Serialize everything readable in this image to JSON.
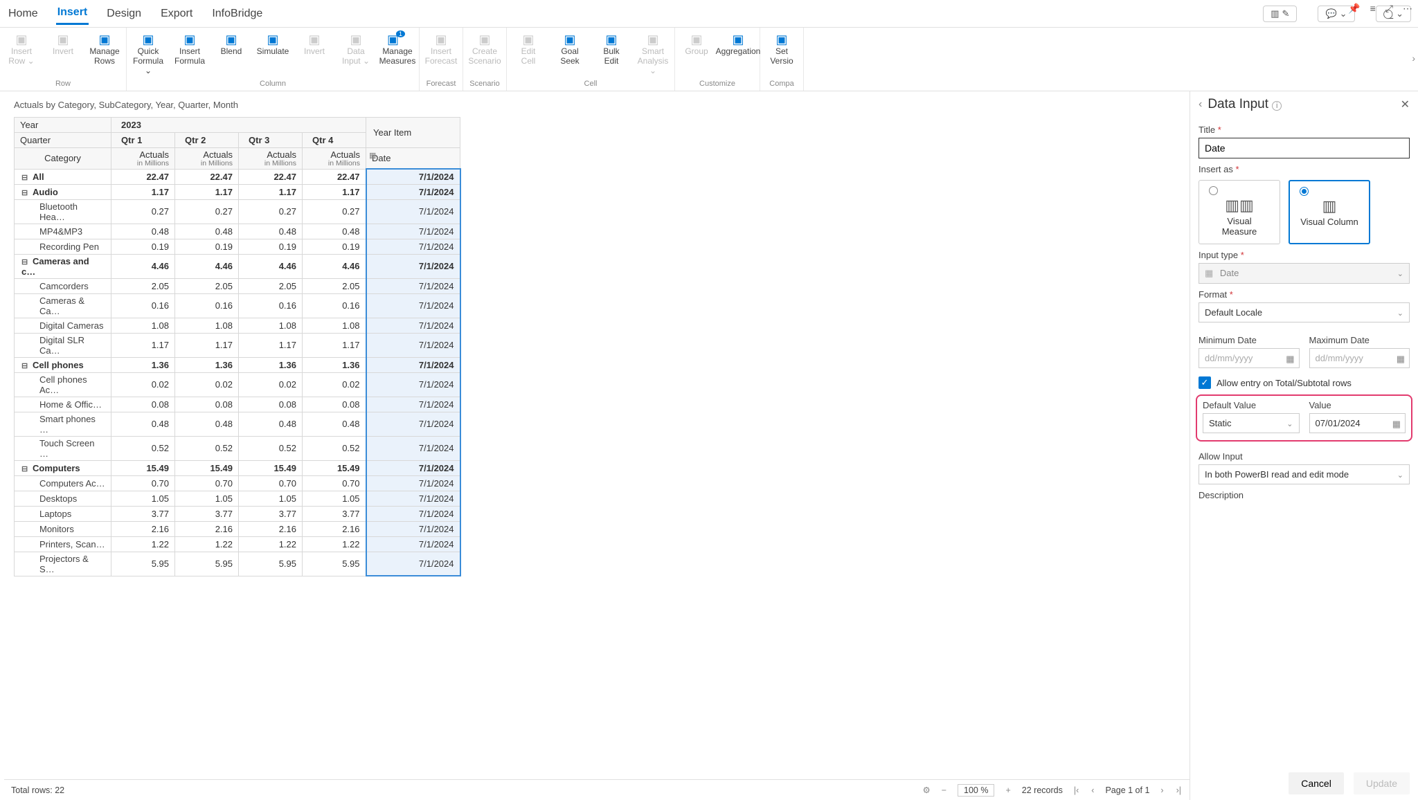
{
  "tabs": [
    "Home",
    "Insert",
    "Design",
    "Export",
    "InfoBridge"
  ],
  "active_tab": 1,
  "ribbon": {
    "groups": [
      {
        "label": "Row",
        "items": [
          {
            "name": "insert-row",
            "label": "Insert Row",
            "icon": "row",
            "disabled": true,
            "chev": true
          },
          {
            "name": "invert",
            "label": "Invert",
            "icon": "invert",
            "disabled": true
          },
          {
            "name": "manage-rows",
            "label": "Manage Rows",
            "icon": "rows",
            "disabled": false
          }
        ]
      },
      {
        "label": "Column",
        "items": [
          {
            "name": "quick-formula",
            "label": "Quick Formula",
            "icon": "bolt",
            "chev": true
          },
          {
            "name": "insert-formula",
            "label": "Insert Formula",
            "icon": "fx"
          },
          {
            "name": "blend",
            "label": "Blend",
            "icon": "blend"
          },
          {
            "name": "simulate",
            "label": "Simulate",
            "icon": "sim"
          },
          {
            "name": "invert-col",
            "label": "Invert",
            "icon": "invertc",
            "disabled": true
          },
          {
            "name": "data-input",
            "label": "Data Input",
            "icon": "di",
            "disabled": true,
            "chev": true
          },
          {
            "name": "manage-measures",
            "label": "Manage Measures",
            "icon": "mm",
            "badge": "1"
          }
        ]
      },
      {
        "label": "Forecast",
        "items": [
          {
            "name": "insert-forecast",
            "label": "Insert Forecast",
            "icon": "fc",
            "disabled": true
          }
        ]
      },
      {
        "label": "Scenario",
        "items": [
          {
            "name": "create-scenario",
            "label": "Create Scenario",
            "icon": "sc",
            "disabled": true
          }
        ]
      },
      {
        "label": "Cell",
        "items": [
          {
            "name": "edit-cell",
            "label": "Edit Cell",
            "icon": "ec",
            "disabled": true
          },
          {
            "name": "goal-seek",
            "label": "Goal Seek",
            "icon": "gs"
          },
          {
            "name": "bulk-edit",
            "label": "Bulk Edit",
            "icon": "be"
          },
          {
            "name": "smart-analysis",
            "label": "Smart Analysis",
            "icon": "sa",
            "disabled": true,
            "chev": true
          }
        ]
      },
      {
        "label": "Customize",
        "items": [
          {
            "name": "group",
            "label": "Group",
            "icon": "grp",
            "disabled": true
          },
          {
            "name": "aggregation",
            "label": "Aggregation",
            "icon": "agg"
          }
        ]
      },
      {
        "label": "Compa",
        "items": [
          {
            "name": "set-version",
            "label": "Set Versio",
            "icon": "sv"
          }
        ]
      }
    ]
  },
  "breadcrumb": "Actuals by Category, SubCategory, Year, Quarter, Month",
  "matrix": {
    "year_label": "Year",
    "quarter_label": "Quarter",
    "category_label": "Category",
    "year_value": "2023",
    "quarters": [
      "Qtr 1",
      "Qtr 2",
      "Qtr 3",
      "Qtr 4"
    ],
    "measure": "Actuals",
    "measure_sub": "in Millions",
    "yearitem_header": "Year Item",
    "yearitem_sub": "Date",
    "rows": [
      {
        "type": "total",
        "label": "All",
        "vals": [
          "22.47",
          "22.47",
          "22.47",
          "22.47"
        ],
        "yi": "7/1/2024"
      },
      {
        "type": "cat",
        "label": "Audio",
        "vals": [
          "1.17",
          "1.17",
          "1.17",
          "1.17"
        ],
        "yi": "7/1/2024"
      },
      {
        "type": "sub",
        "label": "Bluetooth Hea…",
        "vals": [
          "0.27",
          "0.27",
          "0.27",
          "0.27"
        ],
        "yi": "7/1/2024"
      },
      {
        "type": "sub",
        "label": "MP4&MP3",
        "vals": [
          "0.48",
          "0.48",
          "0.48",
          "0.48"
        ],
        "yi": "7/1/2024"
      },
      {
        "type": "sub",
        "label": "Recording Pen",
        "vals": [
          "0.19",
          "0.19",
          "0.19",
          "0.19"
        ],
        "yi": "7/1/2024"
      },
      {
        "type": "cat",
        "label": "Cameras and c…",
        "vals": [
          "4.46",
          "4.46",
          "4.46",
          "4.46"
        ],
        "yi": "7/1/2024"
      },
      {
        "type": "sub",
        "label": "Camcorders",
        "vals": [
          "2.05",
          "2.05",
          "2.05",
          "2.05"
        ],
        "yi": "7/1/2024"
      },
      {
        "type": "sub",
        "label": "Cameras & Ca…",
        "vals": [
          "0.16",
          "0.16",
          "0.16",
          "0.16"
        ],
        "yi": "7/1/2024"
      },
      {
        "type": "sub",
        "label": "Digital Cameras",
        "vals": [
          "1.08",
          "1.08",
          "1.08",
          "1.08"
        ],
        "yi": "7/1/2024"
      },
      {
        "type": "sub",
        "label": "Digital SLR Ca…",
        "vals": [
          "1.17",
          "1.17",
          "1.17",
          "1.17"
        ],
        "yi": "7/1/2024"
      },
      {
        "type": "cat",
        "label": "Cell phones",
        "vals": [
          "1.36",
          "1.36",
          "1.36",
          "1.36"
        ],
        "yi": "7/1/2024"
      },
      {
        "type": "sub",
        "label": "Cell phones Ac…",
        "vals": [
          "0.02",
          "0.02",
          "0.02",
          "0.02"
        ],
        "yi": "7/1/2024"
      },
      {
        "type": "sub",
        "label": "Home & Offic…",
        "vals": [
          "0.08",
          "0.08",
          "0.08",
          "0.08"
        ],
        "yi": "7/1/2024"
      },
      {
        "type": "sub",
        "label": "Smart phones …",
        "vals": [
          "0.48",
          "0.48",
          "0.48",
          "0.48"
        ],
        "yi": "7/1/2024"
      },
      {
        "type": "sub",
        "label": "Touch Screen …",
        "vals": [
          "0.52",
          "0.52",
          "0.52",
          "0.52"
        ],
        "yi": "7/1/2024"
      },
      {
        "type": "cat",
        "label": "Computers",
        "vals": [
          "15.49",
          "15.49",
          "15.49",
          "15.49"
        ],
        "yi": "7/1/2024"
      },
      {
        "type": "sub",
        "label": "Computers Ac…",
        "vals": [
          "0.70",
          "0.70",
          "0.70",
          "0.70"
        ],
        "yi": "7/1/2024"
      },
      {
        "type": "sub",
        "label": "Desktops",
        "vals": [
          "1.05",
          "1.05",
          "1.05",
          "1.05"
        ],
        "yi": "7/1/2024"
      },
      {
        "type": "sub",
        "label": "Laptops",
        "vals": [
          "3.77",
          "3.77",
          "3.77",
          "3.77"
        ],
        "yi": "7/1/2024"
      },
      {
        "type": "sub",
        "label": "Monitors",
        "vals": [
          "2.16",
          "2.16",
          "2.16",
          "2.16"
        ],
        "yi": "7/1/2024"
      },
      {
        "type": "sub",
        "label": "Printers, Scan…",
        "vals": [
          "1.22",
          "1.22",
          "1.22",
          "1.22"
        ],
        "yi": "7/1/2024"
      },
      {
        "type": "sub",
        "label": "Projectors & S…",
        "vals": [
          "5.95",
          "5.95",
          "5.95",
          "5.95"
        ],
        "yi": "7/1/2024"
      }
    ]
  },
  "status": {
    "total_rows": "Total rows: 22",
    "zoom": "100 %",
    "records": "22 records",
    "page": "Page 1 of 1"
  },
  "panel": {
    "title": "Data Input",
    "field_title_label": "Title",
    "field_title_value": "Date",
    "insert_as_label": "Insert as",
    "card_measure": "Visual Measure",
    "card_column": "Visual Column",
    "input_type_label": "Input type",
    "input_type_value": "Date",
    "format_label": "Format",
    "format_value": "Default Locale",
    "min_date_label": "Minimum Date",
    "max_date_label": "Maximum Date",
    "date_placeholder": "dd/mm/yyyy",
    "allow_entry": "Allow entry on Total/Subtotal rows",
    "default_value_label": "Default Value",
    "default_value_value": "Static",
    "value_label": "Value",
    "value_value": "07/01/2024",
    "allow_input_label": "Allow Input",
    "allow_input_value": "In both PowerBI read and edit mode",
    "description_label": "Description",
    "cancel": "Cancel",
    "update": "Update"
  }
}
